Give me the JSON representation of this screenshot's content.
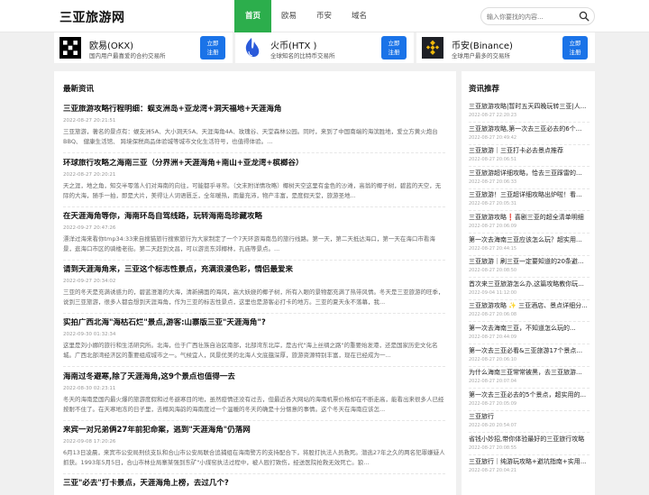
{
  "site": {
    "name": "三亚旅游网"
  },
  "nav": [
    {
      "label": "首页"
    },
    {
      "label": "欧易"
    },
    {
      "label": "币安"
    },
    {
      "label": "域名"
    }
  ],
  "search": {
    "placeholder": "输入你要找的内容..."
  },
  "exchanges": [
    {
      "name": "欧易(OKX)",
      "desc": "国内用户最喜爱的合约交易所",
      "btn": "立即\n注册",
      "icon": "okx-logo",
      "color": "#000000"
    },
    {
      "name": "火币(HTX )",
      "desc": "全球知名的比特币交易所",
      "btn": "立即\n注册",
      "icon": "htx-logo",
      "color": "#2a5ada"
    },
    {
      "name": "币安(Binance)",
      "desc": "全球用户最多的交易所",
      "btn": "立即\n注册",
      "icon": "binance-logo",
      "color": "#f0b90b"
    }
  ],
  "news": {
    "title": "最新资讯",
    "items": [
      {
        "title": "三亚旅游攻略行程明细：蜈支洲岛+亚龙湾+洞天福地+天涯海角",
        "time": "2022-08-27 20:21:51",
        "summary": "三亚旅游，著名的景点有：蜈支洲5A、大小洞天5A、天涯海角4A、玫瑰谷、天堂森林公园。同时，来到了中国南端的海滨胜地，爱立方黄火炮台 BBQ、 健康生活馆、 跨境保税商品体验城等城市文化生活符号，也值得体验。..."
      },
      {
        "title": "环球旅行攻略之海南三亚（分界洲+天涯海角+南山+亚龙湾+槟榔谷）",
        "time": "2022-08-27 20:20:21",
        "summary": "天之涯，地之角，知交半零落人们对海南的向往，可能都乎寻常。（文末附详情攻略）椰树天空这里有金色的沙滩，高翁的椰子树，碧蓝的天空，无际的大海，随手一拍，即是大片，美得让人词语匮乏，全年暖热，雨量充沛，物产丰富，是度假天堂，旅游圣地..."
      },
      {
        "title": "在天涯海角等你，海南环岛自驾线路，玩转海南岛珍藏攻略",
        "time": "2022-09-27 20:47:26",
        "summary": "漂洋过海来看你tmp34:33来自搜猫旅行搜索旅行为大家制定了一个7天环游海南岛的旅行线路。第一天，第二天抵达海口，第一天在海口市看海景，逛海口市区的骑楼老街。第二天赶到文昌，可以游览东郊椰林，孔庙等景点。..."
      },
      {
        "title": "请到天涯海角来，三亚这个标志性景点，充满浪漫色彩，情侣最爱来",
        "time": "2022-09-27 20:34:02",
        "summary": "三亚的冬天是充满诱惑力的，碧蓝澄澈的大海，清新拂面的海风，高大妖娆的椰子树，所有入眼的景物都充满了热带风情。冬天是三亚旅游的旺季，说到三亚旅游，很多人都会想到天涯海角，作为三亚的标志性景点，这里也是游客必打卡的地方。三亚的夏天永不落幕，我..."
      },
      {
        "title": "实拍广西北海\"海枯石烂\"景点,游客:山寨版三亚\"天涯海角\"?",
        "time": "2022-09-30 01:32:34",
        "summary": "这里是刘小娜的旅行和生活研究所。北海，位于广西壮族自治区南部，北部湾东北岸，是古代\"海上丝绸之路\"的重要始发港，还是国家历史文化名城。广西北部湾经济区的重要组成城市之一。气候宜人，风景优美的北海人文底蕴深厚，旅游资源特别丰富，现在已经成为一..."
      },
      {
        "title": "海南过冬避寒,除了天涯海角,这9个景点也值得一去",
        "time": "2022-08-30 02:23:11",
        "summary": "冬天的海南是国内最火爆的旅游度假和过冬避寒目的地，虽然疫情还没有过去，但最近各大网站的海南机票价格却在不断走高，能看出来很多人已经按耐不住了。在天寒地冻的日子里，去椰风海韵的海南度过一个温暖的冬天的确是十分惬意的事情。这个冬天在海南应该怎..."
      },
      {
        "title": "来宾一对兄弟俩27年前犯命案，逃到\"天涯海角\"仍落网",
        "time": "2022-09-08 17:20:26",
        "summary": "6月13日凌晨，来宾市公安局刑侦支队和合山市公安局联合追捕组在海南警方的支持配合下，将股打执法人员救死。潜逃27年之久的两名犯罪嫌疑人抓获。1993年5月5日，合山市林业局寨某强到东矿\"小煤窑执法过程中，被人殴打致伤，经送医院抢救无效死亡。狼..."
      },
      {
        "title": "三亚\"必去\"打卡景点，天涯海角上榜，去过几个?",
        "time": "",
        "summary": ""
      }
    ]
  },
  "recommend": {
    "title": "资讯推荐",
    "items": [
      {
        "title": "三亚旅游攻略|暂时五天四晚玩转三亚|人...",
        "time": "2022-08-27 22:20:23"
      },
      {
        "title": "三亚旅游攻略,第一次去三亚必去的6个...",
        "time": "2022-08-27 20:49:42"
      },
      {
        "title": "三亚旅游｜三亚打卡必去景点推荐",
        "time": "2022-08-27 20:06:51"
      },
      {
        "title": "三亚旅游超详细攻略，恰去三亚踩雷的...",
        "time": "2022-08-27 20:06:33"
      },
      {
        "title": "三亚旅游！三亚超详细攻略出炉啦！看...",
        "time": "2022-08-27 20:05:31"
      },
      {
        "title": "三亚旅游攻略❗️喜剧三亚的超全清单明细",
        "time": "2022-08-27 20:06:09"
      },
      {
        "title": "第一次去海南三亚应该怎么玩？超实用...",
        "time": "2022-08-27 20:44:15"
      },
      {
        "title": "三亚旅游｜刷三亚一定要知道的20条避...",
        "time": "2022-08-27 20:08:50"
      },
      {
        "title": "首次来三亚旅游怎么办,这篇攻略教你玩...",
        "time": "2022-09-04 11:12:00"
      },
      {
        "title": "三亚旅游攻略 ✨ 三亚酒店、景点详细分...",
        "time": "2022-08-27 20:06:08"
      },
      {
        "title": "第一次去海南三亚，不知道怎么玩的...",
        "time": "2022-08-27 20:44:09"
      },
      {
        "title": "第一次去三亚必看&三亚旅游17个景点...",
        "time": "2022-08-27 20:06:10"
      },
      {
        "title": "为什么海南三亚常常被黑，去三亚旅游...",
        "time": "2022-08-27 20:07:04"
      },
      {
        "title": "第一次去三亚必去的5个景点，超实用的...",
        "time": "2022-08-27 20:05:09"
      },
      {
        "title": "三亚旅行",
        "time": "2022-08-20 20:54:07"
      },
      {
        "title": "省钱小妙招,带你体验最好的三亚旅行攻略",
        "time": "2022-08-27 20:08:55"
      },
      {
        "title": "三亚旅行｜纯游玩攻略+避坑指南+实用...",
        "time": "2022-08-27 20:04:21"
      }
    ]
  }
}
